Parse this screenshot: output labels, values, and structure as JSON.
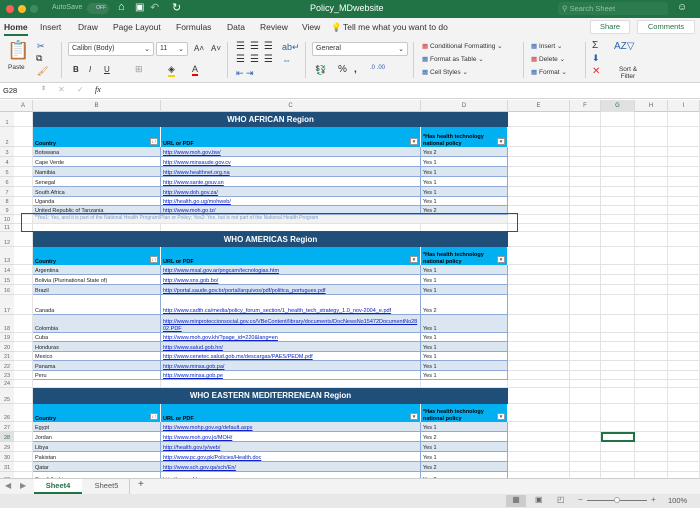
{
  "window": {
    "title": "Policy_MDwebsite",
    "autosave_label": "AutoSave",
    "autosave_state": "OFF",
    "search_placeholder": "Search Sheet"
  },
  "ribbon_tabs": [
    "Home",
    "Insert",
    "Draw",
    "Page Layout",
    "Formulas",
    "Data",
    "Review",
    "View"
  ],
  "active_tab": "Home",
  "tell_me": "Tell me what you want to do",
  "share_label": "Share",
  "comments_label": "Comments",
  "ribbon": {
    "paste": "Paste",
    "font_name": "Calibri (Body)",
    "font_size": "11",
    "number_format": "General",
    "conditional_formatting": "Conditional Formatting",
    "format_as_table": "Format as Table",
    "cell_styles": "Cell Styles",
    "insert": "Insert",
    "delete": "Delete",
    "format": "Format",
    "sort_filter": "Sort & Filter",
    "bold": "B",
    "italic": "I",
    "underline": "U"
  },
  "formula_bar": {
    "name_box": "G28",
    "formula": "",
    "fx": "fx"
  },
  "columns": [
    "A",
    "B",
    "C",
    "D",
    "E",
    "F",
    "G",
    "H",
    "I"
  ],
  "selected_cell": "G28",
  "footnote": "*Yes1: Yes, and it is part of the National Health Program/Plan or Policy; Yes2: Yes, but is not part of the National Health Program",
  "headers": {
    "country": "Country",
    "url": "URL or PDF",
    "policy": "*Has health technology national policy"
  },
  "sections": [
    {
      "title": "WHO AFRICAN Region",
      "rows": [
        [
          "Botswana",
          "http://www.moh.gov.bw/",
          "Yes 2"
        ],
        [
          "Cape Verde",
          "http://www.minsaude.gov.cv",
          "Yes 1"
        ],
        [
          "Namibia",
          "http://www.healthnet.org.na",
          "Yes 1"
        ],
        [
          "Senegal",
          "http://www.sante.gouv.sn",
          "Yes 1"
        ],
        [
          "South Africa",
          "http://www.doh.gov.za/",
          "Yes 1"
        ],
        [
          "Uganda",
          "http://health.go.ug/mohweb/",
          "Yes 1"
        ],
        [
          "United Republic of Tanzania",
          "http://www.moh.go.tz/",
          "Yes 2"
        ]
      ]
    },
    {
      "title": "WHO AMERICAS Region",
      "rows": [
        [
          "Argentina",
          "http://www.msal.gov.ar/pngcam/tecnologias.htm",
          "Yes 1"
        ],
        [
          "Bolivia (Plurinational State of)",
          "http://www.sns.gob.bo/",
          "Yes 1"
        ],
        [
          "Brazil",
          "http://portal.saude.gov.br/portal/arquivos/pdf/politica_portugues.pdf",
          "Yes 1"
        ],
        [
          "Canada",
          "http://www.cadth.ca/media/policy_forum_section/1_health_tech_strategy_1.0_nov-2004_e.pdf",
          "Yes 2"
        ],
        [
          "Colombia",
          "http://www.minproteccionsocial.gov.co/VBeContent/library/documents/DocNewsNo15472DocumentNo2802.PDF",
          "Yes 1"
        ],
        [
          "Cuba",
          "http://www.moh.gov.kh/?page_id=220&lang=en",
          "Yes 1"
        ],
        [
          "Honduras",
          "http://www.salud.gob.hn/",
          "Yes 1"
        ],
        [
          "Mexico",
          "http://www.cenetec.salud.gob.mx/descargas/PAES/PEDM.pdf",
          "Yes 1"
        ],
        [
          "Panama",
          "http://www.minsa.gob.pa/",
          "Yes 1"
        ],
        [
          "Peru",
          "http://www.minsa.gob.pe",
          "Yes 1"
        ]
      ]
    },
    {
      "title": "WHO EASTERN MEDITERRENEAN Region",
      "rows": [
        [
          "Egypt",
          "http://www.mohp.gov.eg/default.aspx",
          "Yes 1"
        ],
        [
          "Jordan",
          "http://www.moh.gov.jo/MOH/",
          "Yes 2"
        ],
        [
          "Libya",
          "http://health.gov.ly/web/",
          "Yes 1"
        ],
        [
          "Pakistan",
          "http://www.pc.gov.pk/Policies/Health.doc",
          "Yes 1"
        ],
        [
          "Qatar",
          "http://www.sch.gov.qa/sch/En/",
          "Yes 2"
        ],
        [
          "Saudi Arabia",
          "http://www.sfda.gov.sa",
          "Yes 2"
        ]
      ]
    }
  ],
  "sheet_tabs": [
    "Sheet4",
    "Sheet5"
  ],
  "active_sheet": "Sheet4",
  "zoom": "100%",
  "colors": {
    "title_bar": "#217346",
    "section_title": "#1f4e79",
    "header": "#00b0f0",
    "band": "#dce6f1",
    "annotation": "#2b3cf0"
  }
}
